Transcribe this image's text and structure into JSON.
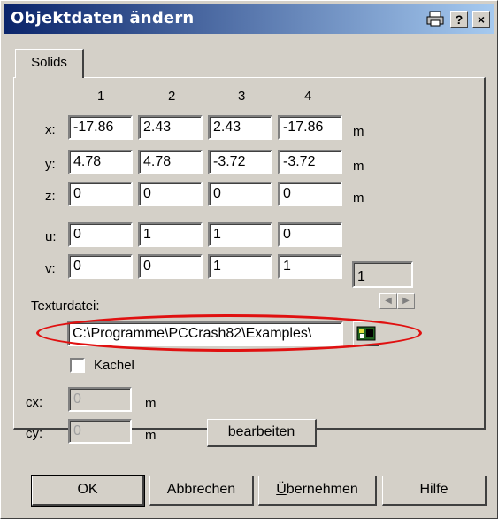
{
  "window": {
    "title": "Objektdaten ändern",
    "help_btn": "?",
    "close_btn": "×"
  },
  "tabs": [
    {
      "label": "Solids"
    }
  ],
  "columns": [
    "1",
    "2",
    "3",
    "4"
  ],
  "rows": [
    {
      "label": "x:",
      "values": [
        "-17.86",
        "2.43",
        "2.43",
        "-17.86"
      ],
      "unit": "m"
    },
    {
      "label": "y:",
      "values": [
        "4.78",
        "4.78",
        "-3.72",
        "-3.72"
      ],
      "unit": "m"
    },
    {
      "label": "z:",
      "values": [
        "0",
        "0",
        "0",
        "0"
      ],
      "unit": "m"
    },
    {
      "label": "u:",
      "values": [
        "0",
        "1",
        "1",
        "0"
      ],
      "unit": ""
    },
    {
      "label": "v:",
      "values": [
        "0",
        "0",
        "1",
        "1"
      ],
      "unit": ""
    }
  ],
  "index_value": "1",
  "texture": {
    "label": "Texturdatei:",
    "value": "C:\\Programme\\PCCrash82\\Examples\\"
  },
  "tile": {
    "label": "Kachel",
    "checked": false
  },
  "cx": {
    "label": "cx:",
    "value": "0",
    "unit": "m"
  },
  "cy": {
    "label": "cy:",
    "value": "0",
    "unit": "m"
  },
  "edit_button": "bearbeiten",
  "buttons": {
    "ok": "OK",
    "cancel": "Abbrechen",
    "apply_u": "Ü",
    "apply_rest": "bernehmen",
    "help": "Hilfe"
  },
  "colors": {
    "titlebar_start": "#0a246a",
    "titlebar_end": "#a6caf0",
    "highlight": "#e01010"
  }
}
